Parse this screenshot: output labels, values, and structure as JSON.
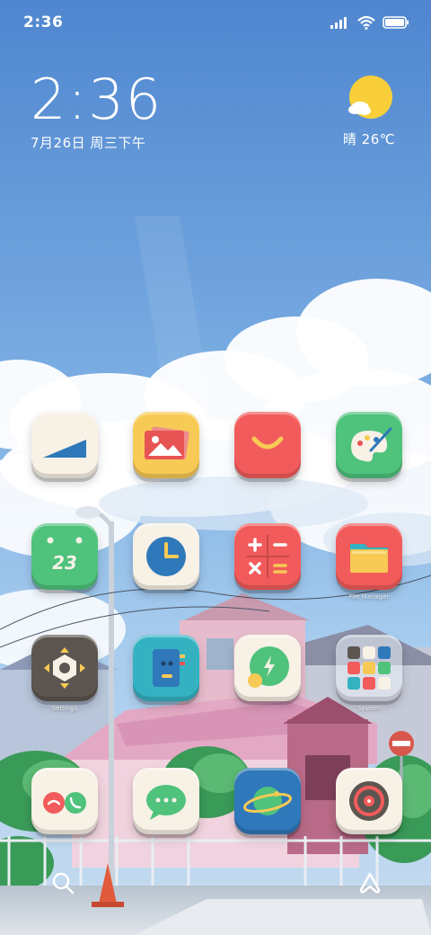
{
  "status_bar": {
    "time": "2:36",
    "icons": [
      "signal-icon",
      "wifi-icon",
      "battery-icon"
    ]
  },
  "clock_widget": {
    "time": "2:36",
    "date": "7月26日 周三下午"
  },
  "weather_widget": {
    "icon": "sunny-cloud-icon",
    "text": "晴 26℃"
  },
  "apps": [
    {
      "id": "signal-app",
      "label": "",
      "icon": "signal-strength-icon",
      "color": "#f8f1e6"
    },
    {
      "id": "gallery",
      "label": "",
      "icon": "gallery-icon",
      "color": "#f7ca55"
    },
    {
      "id": "mi-store",
      "label": "",
      "icon": "store-smile-icon",
      "color": "#f25b5b"
    },
    {
      "id": "themes",
      "label": "",
      "icon": "palette-icon",
      "color": "#4fc27c"
    },
    {
      "id": "calendar",
      "label": "",
      "icon": "calendar-icon",
      "color": "#4fc27c",
      "text": "23"
    },
    {
      "id": "clock",
      "label": "",
      "icon": "clock-icon",
      "color": "#f8f1e6"
    },
    {
      "id": "calculator",
      "label": "",
      "icon": "calculator-icon",
      "color": "#f25b5b"
    },
    {
      "id": "file-manager",
      "label": "File Manager",
      "icon": "folder-icon",
      "color": "#f25b5b"
    },
    {
      "id": "settings",
      "label": "Settings",
      "icon": "gear-hex-icon",
      "color": "#5d5650"
    },
    {
      "id": "notes",
      "label": "",
      "icon": "notebook-icon",
      "color": "#35b2c2"
    },
    {
      "id": "security",
      "label": "",
      "icon": "security-bolt-icon",
      "color": "#f8f1e6"
    },
    {
      "id": "system",
      "label": "System",
      "icon": "folder-grid-icon",
      "color": "#ebf0f8"
    },
    {
      "id": "phone",
      "label": "",
      "icon": "phone-icon",
      "color": "#f8f1e6"
    },
    {
      "id": "messages",
      "label": "",
      "icon": "message-icon",
      "color": "#f8f1e6"
    },
    {
      "id": "browser",
      "label": "",
      "icon": "planet-icon",
      "color": "#2f78ba"
    },
    {
      "id": "music",
      "label": "",
      "icon": "vinyl-icon",
      "color": "#f8f1e6"
    }
  ],
  "dock": {
    "left_icon": "search-icon",
    "right_icon": "assistant-icon"
  }
}
